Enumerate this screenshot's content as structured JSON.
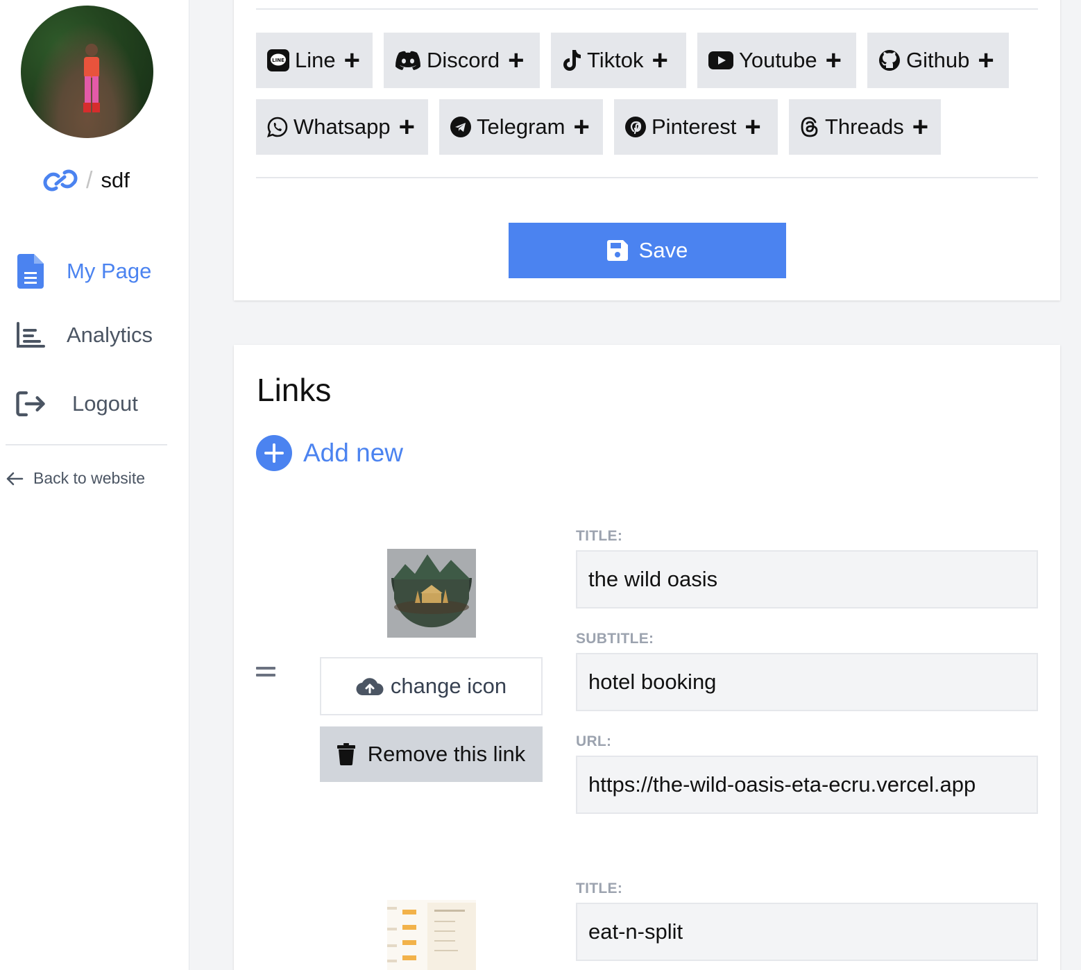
{
  "sidebar": {
    "username": "sdf",
    "separator": "/",
    "nav": {
      "my_page": "My Page",
      "analytics": "Analytics",
      "logout": "Logout"
    },
    "back_to_website": "Back to website"
  },
  "socials": {
    "line": "Line",
    "discord": "Discord",
    "tiktok": "Tiktok",
    "youtube": "Youtube",
    "github": "Github",
    "whatsapp": "Whatsapp",
    "telegram": "Telegram",
    "pinterest": "Pinterest",
    "threads": "Threads",
    "plus": "+"
  },
  "save_label": "Save",
  "links_section": {
    "title": "Links",
    "add_new": "Add new",
    "change_icon": "change icon",
    "remove_link": "Remove this link",
    "labels": {
      "title": "TITLE:",
      "subtitle": "SUBTITLE:",
      "url": "URL:"
    },
    "items": [
      {
        "title": "the wild oasis",
        "subtitle": "hotel booking",
        "url": "https://the-wild-oasis-eta-ecru.vercel.app"
      },
      {
        "title": "eat-n-split"
      }
    ]
  },
  "colors": {
    "accent": "#4b83f0",
    "button_gray": "#e5e7eb",
    "remove_gray": "#d1d5db"
  }
}
